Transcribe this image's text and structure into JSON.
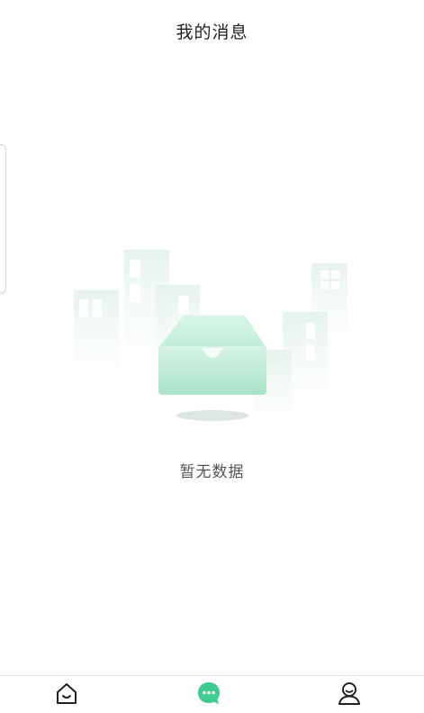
{
  "header": {
    "title": "我的消息"
  },
  "empty_state": {
    "text": "暂无数据",
    "icon": "empty-inbox-illustration"
  },
  "tabbar": {
    "items": [
      {
        "icon": "home-icon",
        "active": false
      },
      {
        "icon": "chat-bubble-icon",
        "active": true
      },
      {
        "icon": "user-icon",
        "active": false
      }
    ]
  },
  "colors": {
    "accent": "#3ecb8f",
    "text_primary": "#222222",
    "text_secondary": "#555555",
    "illustration_green": "#bfe9d6"
  }
}
